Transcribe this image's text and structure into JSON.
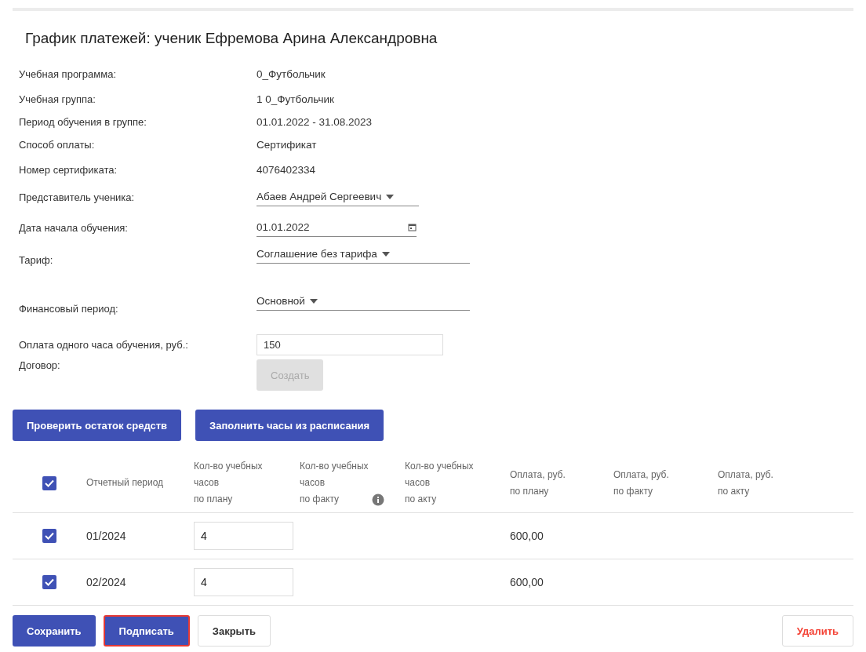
{
  "title": "График платежей: ученик Ефремова Арина Александровна",
  "fields": [
    {
      "kind": "text",
      "label": "Учебная программа:",
      "value": "0_Футбольчик"
    },
    {
      "kind": "text",
      "label": "Учебная группа:",
      "value": "1 0_Футбольчик"
    },
    {
      "kind": "text",
      "label": "Период обучения в группе:",
      "value": "01.01.2022 - 31.08.2023"
    },
    {
      "kind": "text",
      "label": "Способ оплаты:",
      "value": "Сертификат"
    },
    {
      "kind": "text",
      "label": "Номер сертификата:",
      "value": "4076402334"
    },
    {
      "kind": "select",
      "label": "Представитель ученика:",
      "value": "Абаев Андрей Сергеевич"
    },
    {
      "kind": "date",
      "label": "Дата начала обучения:",
      "value": "01.01.2022"
    },
    {
      "kind": "wide_select",
      "label": "Тариф:",
      "value": "Соглашение без тарифа"
    },
    {
      "kind": "wide_select",
      "label": "Финансовый период:",
      "value": "Основной"
    },
    {
      "kind": "input",
      "label": "Оплата одного часа обучения, руб.:",
      "value": "150"
    },
    {
      "kind": "button",
      "label": "Договор:",
      "value": "Создать",
      "disabled": true
    }
  ],
  "actions": [
    "Проверить остаток средств",
    "Заполнить часы из расписания"
  ],
  "table": {
    "all_checked": true,
    "columns": [
      {
        "lines": [
          "Отчетный период"
        ],
        "info": false
      },
      {
        "lines": [
          "Кол-во учебных",
          "часов",
          "по плану"
        ],
        "info": false
      },
      {
        "lines": [
          "Кол-во учебных",
          "часов",
          "по факту"
        ],
        "info": true
      },
      {
        "lines": [
          "Кол-во учебных",
          "часов",
          "по акту"
        ],
        "info": false
      },
      {
        "lines": [
          "Оплата, руб.",
          "по плану"
        ],
        "info": false
      },
      {
        "lines": [
          "Оплата, руб.",
          "по факту"
        ],
        "info": false
      },
      {
        "lines": [
          "Оплата, руб.",
          "по акту"
        ],
        "info": false
      }
    ],
    "rows": [
      {
        "checked": true,
        "period": "01/2024",
        "hours_plan": "4",
        "pay_plan": "600,00"
      },
      {
        "checked": true,
        "period": "02/2024",
        "hours_plan": "4",
        "pay_plan": "600,00"
      }
    ]
  },
  "footer": [
    {
      "label": "Сохранить",
      "kind": "primary",
      "highlighted": false
    },
    {
      "label": "Подписать",
      "kind": "primary",
      "highlighted": true
    },
    {
      "label": "Закрыть",
      "kind": "outline",
      "highlighted": false
    },
    {
      "label": "Удалить",
      "kind": "danger",
      "highlighted": false
    }
  ]
}
